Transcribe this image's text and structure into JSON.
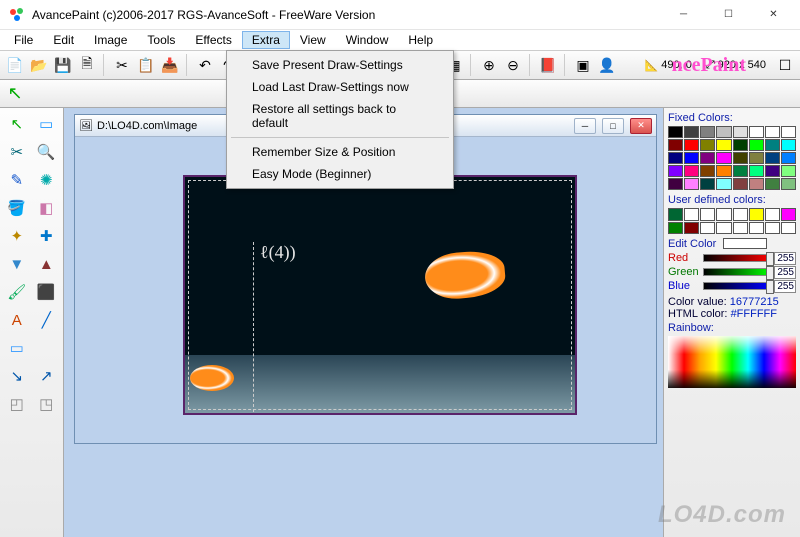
{
  "window": {
    "title": "AvancePaint (c)2006-2017 RGS-AvanceSoft - FreeWare Version",
    "brand_fragment": "ncePaint"
  },
  "menu": {
    "items": [
      "File",
      "Edit",
      "Image",
      "Tools",
      "Effects",
      "Extra",
      "View",
      "Window",
      "Help"
    ],
    "active_index": 5
  },
  "extra_menu": {
    "group1": [
      "Save Present Draw-Settings",
      "Load Last Draw-Settings now",
      "Restore all settings back to default"
    ],
    "group2": [
      "Remember Size & Position",
      "Easy Mode (Beginner)"
    ]
  },
  "toolbar": {
    "icons": [
      "new-icon",
      "open-icon",
      "save-icon",
      "save-as-icon",
      "cut-icon",
      "copy-icon",
      "paste-icon",
      "undo-icon",
      "redo-icon",
      "font-icon",
      "pick-color-icon",
      "zoom-in-icon",
      "home-icon",
      "print-icon",
      "camera-icon",
      "scanner-icon",
      "grid-icon",
      "magnify-plus-icon",
      "magnify-minus-icon",
      "book-icon",
      "window-icon",
      "person-icon"
    ],
    "coord_label": "490, 0",
    "size_label": "920 x 540"
  },
  "tools": {
    "items": [
      {
        "name": "pointer-icon",
        "glyph": "↖",
        "color": "#0a0"
      },
      {
        "name": "marquee-icon",
        "glyph": "▭",
        "color": "#29f"
      },
      {
        "name": "crop-icon",
        "glyph": "✂",
        "color": "#067"
      },
      {
        "name": "zoom-icon",
        "glyph": "🔍",
        "color": "#27c"
      },
      {
        "name": "pencil-icon",
        "glyph": "✎",
        "color": "#15c"
      },
      {
        "name": "spray-icon",
        "glyph": "✺",
        "color": "#0aa"
      },
      {
        "name": "bucket-icon",
        "glyph": "🪣",
        "color": "#c60"
      },
      {
        "name": "eraser-icon",
        "glyph": "◧",
        "color": "#c7a"
      },
      {
        "name": "shapes-icon",
        "glyph": "✦",
        "color": "#b80"
      },
      {
        "name": "crosshair-icon",
        "glyph": "✚",
        "color": "#07c"
      },
      {
        "name": "filter-icon",
        "glyph": "▼",
        "color": "#38c"
      },
      {
        "name": "lamp-icon",
        "glyph": "▲",
        "color": "#833"
      },
      {
        "name": "brush-icon",
        "glyph": "🖌",
        "color": "#0a5"
      },
      {
        "name": "roller-icon",
        "glyph": "⬛",
        "color": "#0a5"
      },
      {
        "name": "text-icon",
        "glyph": "A",
        "color": "#c40"
      },
      {
        "name": "line-icon",
        "glyph": "╱",
        "color": "#06c"
      },
      {
        "name": "screen-icon",
        "glyph": "▭",
        "color": "#39f"
      },
      {
        "name": "blank1",
        "glyph": "",
        "color": "#fff"
      },
      {
        "name": "picker-icon",
        "glyph": "↘",
        "color": "#05a"
      },
      {
        "name": "dropper-icon",
        "glyph": "↗",
        "color": "#05a"
      },
      {
        "name": "bg-icon",
        "glyph": "◰",
        "color": "#888"
      },
      {
        "name": "fg-icon",
        "glyph": "◳",
        "color": "#888"
      }
    ]
  },
  "child": {
    "title": "D:\\LO4D.com\\Image",
    "scribble": "ℓ(4))"
  },
  "colors": {
    "fixed_label": "Fixed Colors:",
    "user_label": "User defined colors:",
    "edit_label": "Edit Color",
    "fixed": [
      "#000000",
      "#404040",
      "#808080",
      "#c0c0c0",
      "#e0e0e0",
      "#ffffff",
      "#ffffff",
      "#ffffff",
      "#800000",
      "#ff0000",
      "#808000",
      "#ffff00",
      "#004000",
      "#00ff00",
      "#008080",
      "#00ffff",
      "#000080",
      "#0000ff",
      "#800080",
      "#ff00ff",
      "#404000",
      "#808040",
      "#004080",
      "#0080ff",
      "#8000ff",
      "#ff0080",
      "#804000",
      "#ff8000",
      "#008040",
      "#00ff80",
      "#400080",
      "#80ff80",
      "#400040",
      "#ff80ff",
      "#004040",
      "#80ffff",
      "#804040",
      "#c08080",
      "#408040",
      "#80c080"
    ],
    "user": [
      "#006633",
      "#ffffff",
      "#ffffff",
      "#ffffff",
      "#ffffff",
      "#ffff00",
      "#ffffff",
      "#ff00ff",
      "#008000",
      "#800000",
      "#ffffff",
      "#ffffff",
      "#ffffff",
      "#ffffff",
      "#ffffff",
      "#ffffff"
    ],
    "red": {
      "label": "Red",
      "value": "255",
      "track": "linear-gradient(to right,#000,#f00)"
    },
    "green": {
      "label": "Green",
      "value": "255",
      "track": "linear-gradient(to right,#000,#0f0)"
    },
    "blue": {
      "label": "Blue",
      "value": "255",
      "track": "linear-gradient(to right,#000,#00f)"
    },
    "color_value_label": "Color value:",
    "color_value": "16777215",
    "html_label": "HTML color:",
    "html_value": "#FFFFFF",
    "rainbow_label": "Rainbow:"
  }
}
